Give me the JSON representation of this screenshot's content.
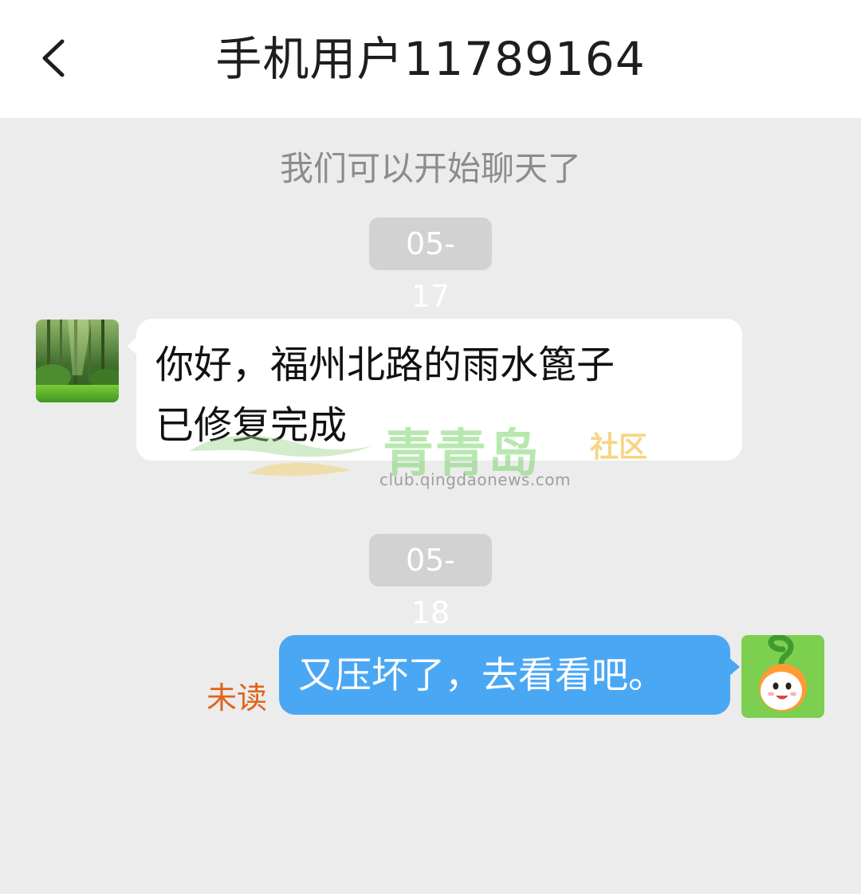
{
  "header": {
    "title": "手机用户11789164"
  },
  "chat": {
    "system_message": "我们可以开始聊天了",
    "messages": [
      {
        "date": "05-17",
        "text_line1": "你好，福州北路的雨水篦子",
        "text_line2": "已修复完成"
      },
      {
        "date": "05-18",
        "text": "又压坏了，去看看吧。",
        "status": "未读"
      }
    ]
  },
  "watermark": {
    "brand": "青青岛",
    "community": "社区",
    "domain": "club.qingdaonews.com"
  },
  "colors": {
    "header_bg": "#ffffff",
    "chat_bg": "#ececec",
    "bubble_in": "#ffffff",
    "bubble_out": "#4aa7f4",
    "unread_text": "#e0641a"
  }
}
